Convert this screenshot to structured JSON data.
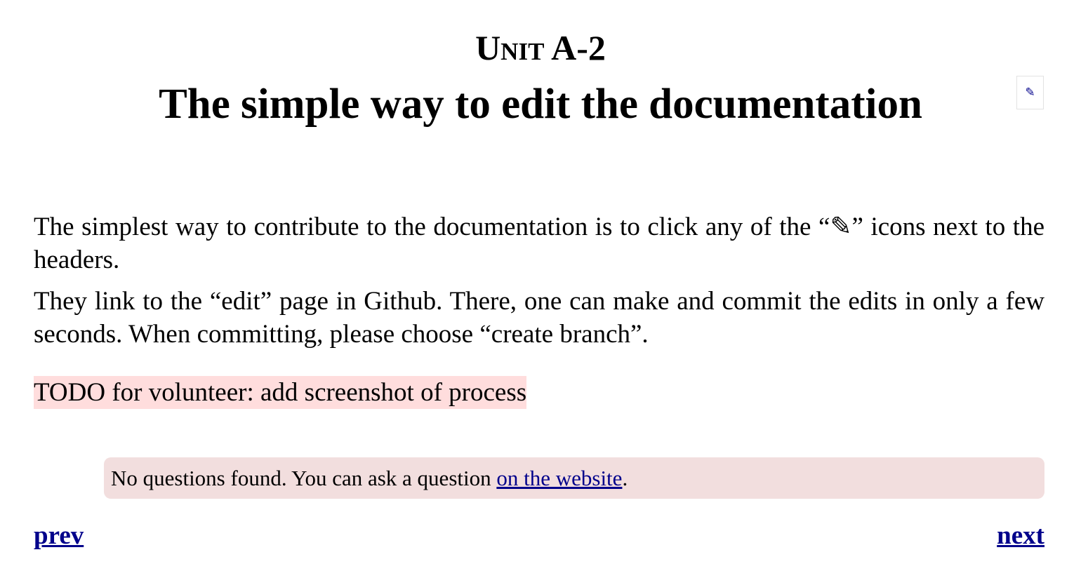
{
  "header": {
    "unit_label": "Unit A-2",
    "title": "The simple way to edit the documentation",
    "edit_icon": "✎"
  },
  "content": {
    "paragraph_1": "The simplest way to contribute to the documentation is to click any of the “✎” icons next to the headers.",
    "paragraph_2": "They link to the “edit” page in Github. There, one can make and commit the edits in only a few seconds. When committing, please choose “create branch”.",
    "todo": "TODO for volunteer: add screenshot of process"
  },
  "questions": {
    "text": "No questions found. You can ask a question ",
    "link_label": "on the website",
    "suffix": "."
  },
  "navigation": {
    "prev_label": "prev",
    "next_label": "next"
  },
  "colors": {
    "link": "#00008b",
    "todo_background": "#ffdddd",
    "questions_background": "#f2dede"
  }
}
